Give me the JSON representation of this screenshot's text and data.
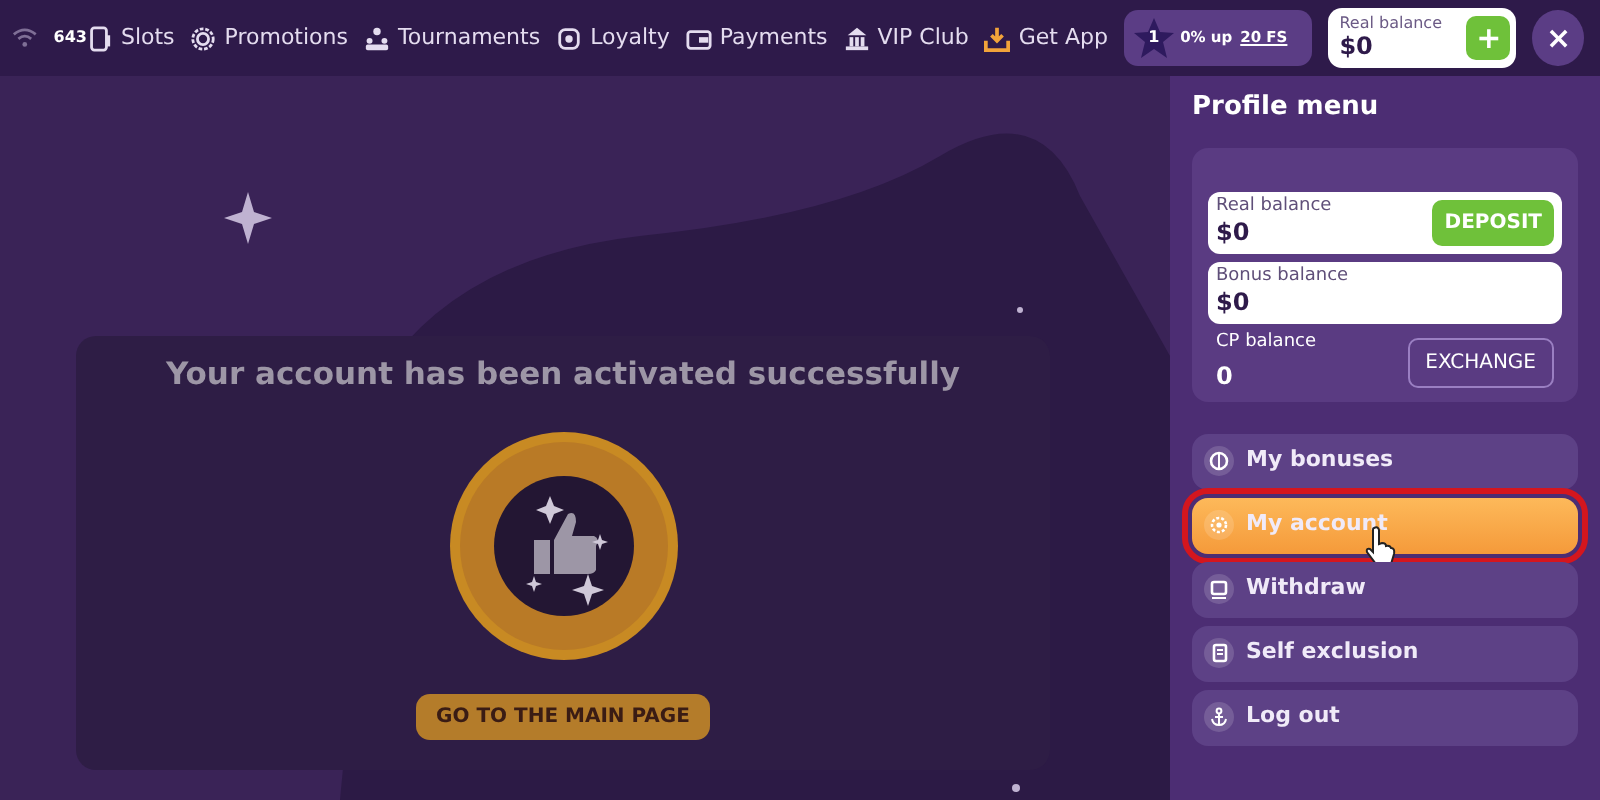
{
  "top_bar": {
    "signal_count": "643",
    "nav": [
      {
        "kind": "slots",
        "label": "Slots"
      },
      {
        "kind": "promotions",
        "label": "Promotions"
      },
      {
        "kind": "tournaments",
        "label": "Tournaments"
      },
      {
        "kind": "loyalty",
        "label": "Loyalty"
      },
      {
        "kind": "payments",
        "label": "Payments"
      },
      {
        "kind": "vip",
        "label": "VIP Club"
      },
      {
        "kind": "app",
        "label": "Get App"
      }
    ],
    "level": {
      "number": "1",
      "progress_text": "0% up",
      "reward_link": "20 FS"
    },
    "balance": {
      "label": "Real balance",
      "amount": "$0",
      "add_button": "+"
    },
    "close_button": "×"
  },
  "modal": {
    "title": "Your account has been activated successfully",
    "button": "GO TO THE MAIN PAGE"
  },
  "profile_menu": {
    "title": "Profile menu",
    "real_balance": {
      "label": "Real balance",
      "amount": "$0",
      "button": "DEPOSIT"
    },
    "bonus_balance": {
      "label": "Bonus balance",
      "amount": "$0"
    },
    "cp_balance": {
      "label": "CP balance",
      "amount": "0",
      "button": "EXCHANGE"
    },
    "items": [
      {
        "kind": "bonuses",
        "label": "My bonuses",
        "selected": false
      },
      {
        "kind": "account",
        "label": "My account",
        "selected": true
      },
      {
        "kind": "withdraw",
        "label": "Withdraw",
        "selected": false
      },
      {
        "kind": "exclusion",
        "label": "Self exclusion",
        "selected": false
      },
      {
        "kind": "logout",
        "label": "Log out",
        "selected": false
      }
    ]
  }
}
